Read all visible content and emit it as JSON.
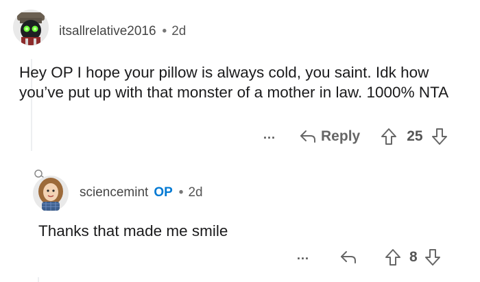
{
  "comment": {
    "username": "itsallrelative2016",
    "separator": "•",
    "age": "2d",
    "body": "Hey OP I hope your pillow is always cold, you saint. Idk how you’ve put up with that monster of a mother in law. 1000% NTA",
    "more_label": "...",
    "reply_label": "Reply",
    "score": "25"
  },
  "reply": {
    "username": "sciencemint",
    "badge": "OP",
    "separator": "•",
    "age": "2d",
    "body": "Thanks that made me smile",
    "more_label": "...",
    "score": "8"
  },
  "icons": {
    "reply": "reply-arrow-icon",
    "upvote": "upvote-arrow-icon",
    "downvote": "downvote-arrow-icon"
  },
  "colors": {
    "op_badge": "#0079d3",
    "meta_text": "#555555",
    "thread_line": "#edeff1"
  }
}
